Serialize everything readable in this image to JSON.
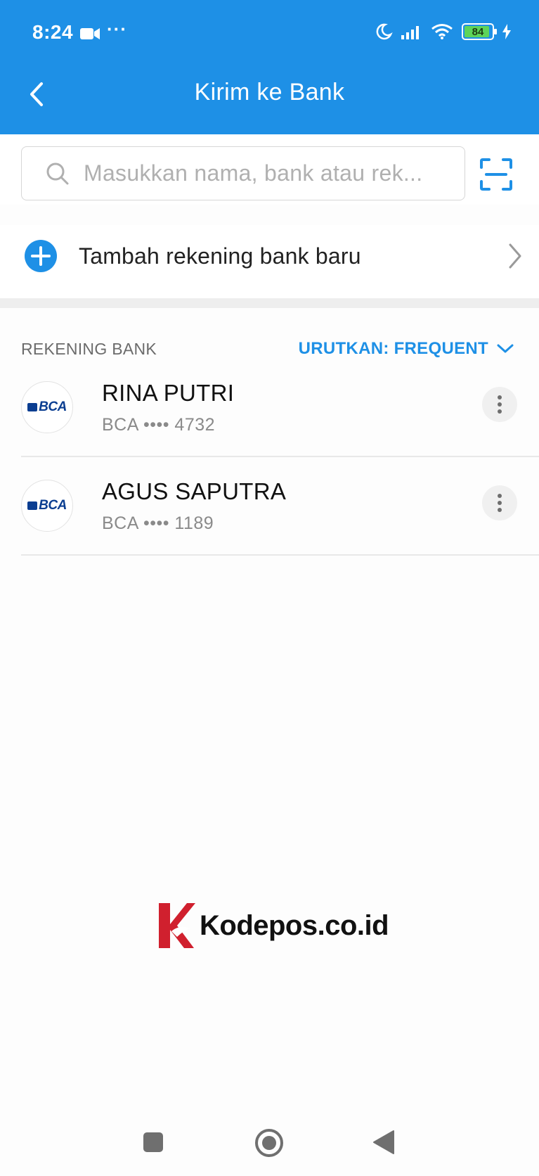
{
  "status_bar": {
    "time": "8:24",
    "dots": "···",
    "battery": "84",
    "icons": [
      "video-icon",
      "moon-icon",
      "signal-icon",
      "wifi-icon",
      "battery-icon",
      "charging-icon"
    ]
  },
  "header": {
    "title": "Kirim ke Bank",
    "back_icon": "back-chevron-icon"
  },
  "search": {
    "placeholder": "Masukkan nama, bank atau rek...",
    "scan_icon": "scan-icon"
  },
  "add_account": {
    "label": "Tambah rekening bank baru"
  },
  "section": {
    "title": "REKENING BANK",
    "sort_label": "URUTKAN: FREQUENT"
  },
  "accounts": [
    {
      "name": "RINA PUTRI",
      "bank": "BCA",
      "masked_number": "BCA •••• 4732",
      "logo_text": "BCA"
    },
    {
      "name": "AGUS SAPUTRA",
      "bank": "BCA",
      "masked_number": "BCA •••• 1189",
      "logo_text": "BCA"
    }
  ],
  "watermark": {
    "text": "Kodepos.co.id"
  },
  "colors": {
    "primary": "#1e90e6",
    "brand_bca": "#0b3e91",
    "watermark_red": "#d0202e"
  }
}
